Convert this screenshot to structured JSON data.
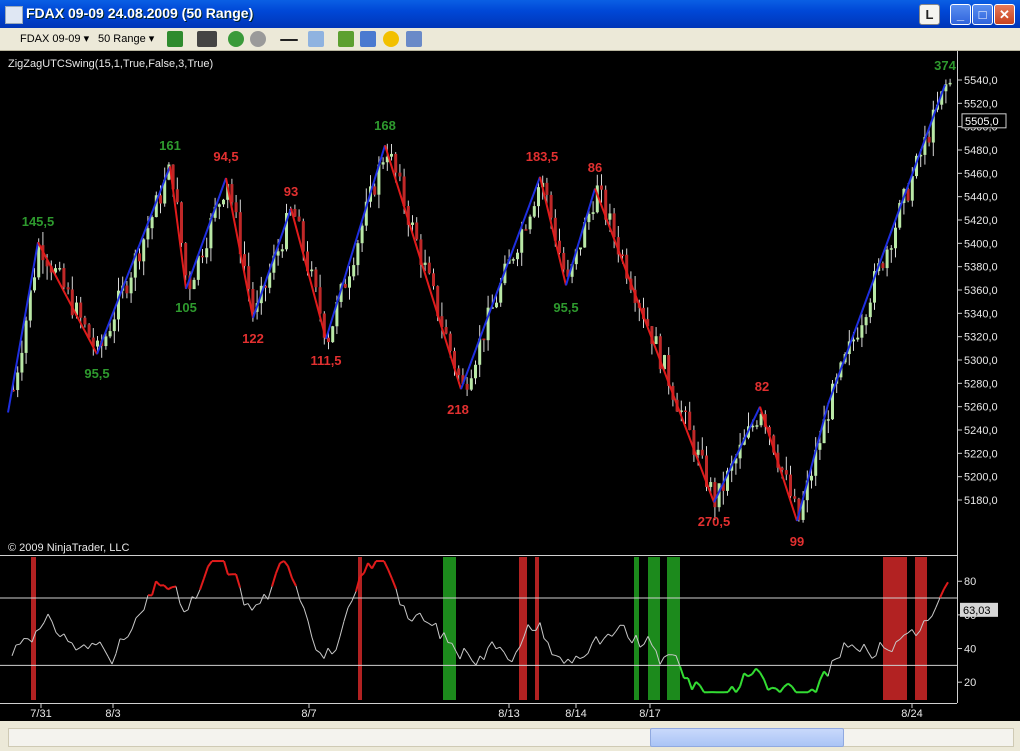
{
  "window": {
    "title": "FDAX 09-09  24.08.2009 (50 Range)"
  },
  "title_buttons": {
    "l": "L",
    "min": "_",
    "max": "□",
    "close": "✕"
  },
  "toolbar": {
    "instrument": "FDAX 09-09",
    "period": "50 Range"
  },
  "chart": {
    "indicator_label": "ZigZagUTCSwing(15,1,True,False,3,True)",
    "copyright": "© 2009 NinjaTrader, LLC",
    "current_price": "5505,0",
    "osc_value": "63,03",
    "price_ticks": [
      "5540,0",
      "5520,0",
      "5500,0",
      "5480,0",
      "5460,0",
      "5440,0",
      "5420,0",
      "5400,0",
      "5380,0",
      "5360,0",
      "5340,0",
      "5320,0",
      "5300,0",
      "5280,0",
      "5260,0",
      "5240,0",
      "5220,0",
      "5200,0",
      "5180,0"
    ],
    "osc_ticks": [
      "80",
      "60",
      "40",
      "20"
    ],
    "date_labels": [
      "7/31",
      "8/3",
      "8/7",
      "8/13",
      "8/14",
      "8/17",
      "8/24"
    ],
    "swing_labels": [
      {
        "text": "145,5",
        "color": "green"
      },
      {
        "text": "95,5",
        "color": "green"
      },
      {
        "text": "161",
        "color": "green"
      },
      {
        "text": "105",
        "color": "green"
      },
      {
        "text": "94,5",
        "color": "red"
      },
      {
        "text": "122",
        "color": "red"
      },
      {
        "text": "93",
        "color": "red"
      },
      {
        "text": "111,5",
        "color": "red"
      },
      {
        "text": "168",
        "color": "green"
      },
      {
        "text": "218",
        "color": "red"
      },
      {
        "text": "183,5",
        "color": "red"
      },
      {
        "text": "95,5",
        "color": "green"
      },
      {
        "text": "86",
        "color": "red"
      },
      {
        "text": "270,5",
        "color": "red"
      },
      {
        "text": "82",
        "color": "red"
      },
      {
        "text": "99",
        "color": "red"
      },
      {
        "text": "374",
        "color": "green"
      }
    ]
  },
  "chart_data": {
    "type": "line",
    "zigzag_x": [
      "start",
      "7/31",
      "7/31b",
      "8/3",
      "8/3b",
      "8/4",
      "8/5",
      "8/6",
      "8/7",
      "8/10",
      "8/11",
      "8/13",
      "8/13b",
      "8/14",
      "8/17",
      "8/18",
      "8/19",
      "8/20",
      "8/24"
    ],
    "zigzag_y": [
      5255,
      5401,
      5305,
      5466,
      5361,
      5456,
      5336,
      5430,
      5318,
      5484,
      5275,
      5457,
      5364,
      5447,
      5178,
      5260,
      5162,
      5262,
      5536
    ],
    "colors": {
      "up": "#1f2fe0",
      "down": "#e01b1b",
      "swing_green": "#2e9a2e",
      "swing_red": "#e23030",
      "bull_candle": "#b9e8a6",
      "bear_candle": "#c02828"
    },
    "price_ylim": [
      5160,
      5550
    ],
    "osc_ylim": [
      10,
      95
    ],
    "osc_levels": [
      70,
      30
    ]
  }
}
